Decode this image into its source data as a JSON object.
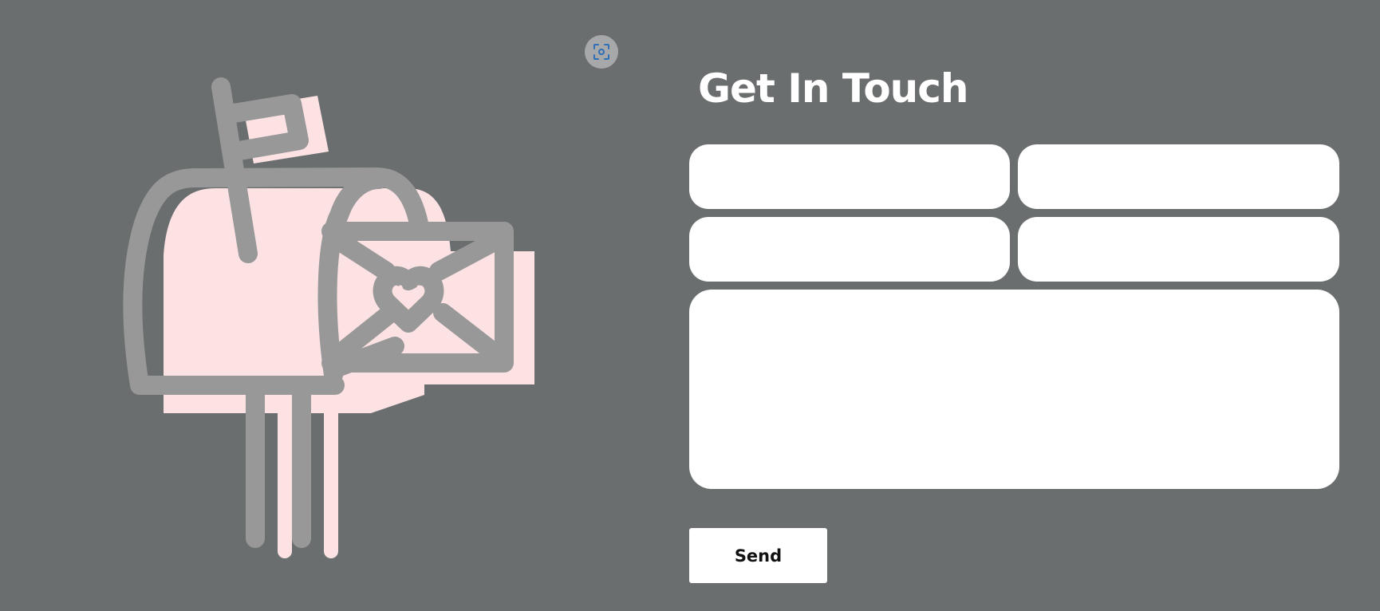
{
  "contact": {
    "title": "Get In Touch",
    "fields": {
      "first_name": {
        "value": "",
        "placeholder": ""
      },
      "last_name": {
        "value": "",
        "placeholder": ""
      },
      "email": {
        "value": "",
        "placeholder": ""
      },
      "phone": {
        "value": "",
        "placeholder": ""
      },
      "message": {
        "value": "",
        "placeholder": ""
      }
    },
    "send_label": "Send"
  },
  "icons": {
    "screenshot": "scan-camera-icon",
    "illustration": "mailbox-with-heart-letter-illustration"
  },
  "colors": {
    "background": "#6b6e6f",
    "illustration_outline": "#989898",
    "illustration_fill": "#fde2e4",
    "field_background": "#ffffff",
    "button_background": "#ffffff",
    "screenshot_icon": "#2f6fb8"
  }
}
